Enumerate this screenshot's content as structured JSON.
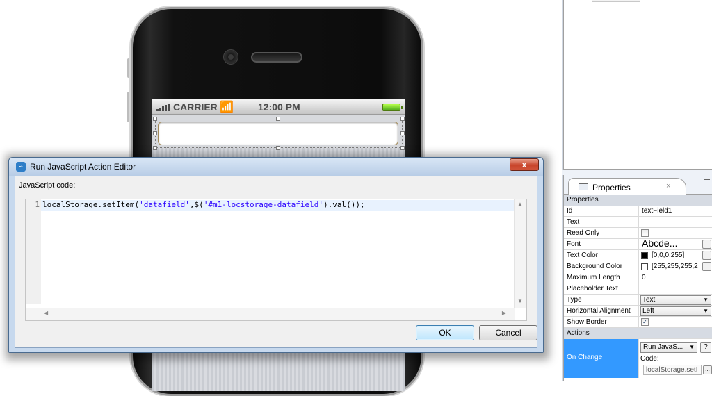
{
  "phone": {
    "status_bar": {
      "carrier": "CARRIER",
      "time": "12:00 PM"
    }
  },
  "dialog": {
    "title": "Run JavaScript Action Editor",
    "close_label": "x",
    "js_code_label": "JavaScript code:",
    "editor": {
      "line_number": "1",
      "code_prefix": "localStorage.setItem(",
      "code_str1": "'datafield'",
      "code_mid": ",$(",
      "code_str2": "'#m1-locstorage-datafield'",
      "code_suffix": ").val());"
    },
    "ok_label": "OK",
    "cancel_label": "Cancel"
  },
  "properties": {
    "tab_label": "Properties",
    "tab_close": "×",
    "section_header": "Properties",
    "rows": {
      "id": {
        "name": "Id",
        "value": "textField1"
      },
      "text": {
        "name": "Text",
        "value": ""
      },
      "read_only": {
        "name": "Read Only",
        "checked": false
      },
      "font": {
        "name": "Font",
        "value": "Abcde..."
      },
      "text_color": {
        "name": "Text Color",
        "value": "[0,0,0,255]",
        "swatch": "#000000"
      },
      "background_color": {
        "name": "Background Color",
        "value": "[255,255,255,2",
        "swatch": "#ffffff"
      },
      "max_length": {
        "name": "Maximum Length",
        "value": "0"
      },
      "placeholder": {
        "name": "Placeholder Text",
        "value": ""
      },
      "type": {
        "name": "Type",
        "value": "Text"
      },
      "h_align": {
        "name": "Horizontal Alignment",
        "value": "Left"
      },
      "show_border": {
        "name": "Show Border",
        "checked": true
      }
    },
    "actions_header": "Actions",
    "on_change": {
      "name": "On Change",
      "action": "Run JavaS...",
      "help": "?",
      "code_label": "Code:",
      "code_value": "localStorage.setI"
    }
  },
  "colors": {
    "selection_blue": "#3399ff",
    "dialog_frame": "#c7d9ee",
    "string_literal": "#2a00ff"
  },
  "icons": [
    "wifi-icon",
    "signal-bars-icon",
    "battery-icon",
    "dialog-app-icon",
    "close-icon",
    "properties-tab-icon",
    "scroll-up-icon",
    "scroll-down-icon",
    "scroll-left-icon",
    "scroll-right-icon",
    "dropdown-arrow-icon",
    "ellipsis-button-icon",
    "minimize-icon"
  ]
}
